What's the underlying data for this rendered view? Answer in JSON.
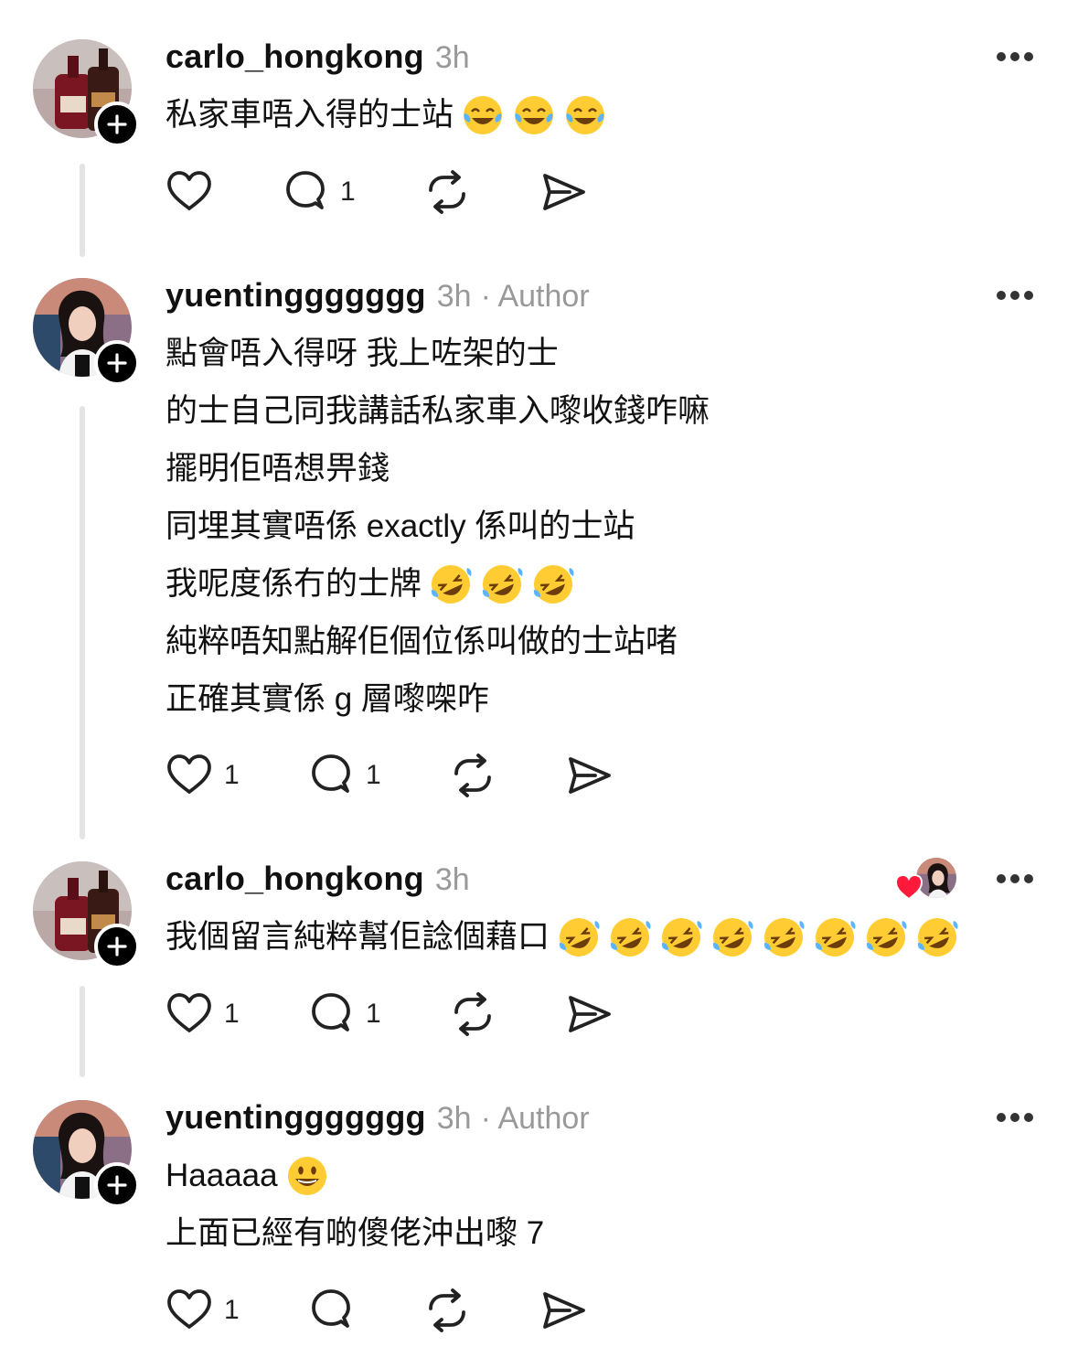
{
  "colors": {
    "text": "#111111",
    "meta": "#999999",
    "thread_line": "#e4e4e4",
    "heart": "#ff1a3c"
  },
  "icons": {
    "like": "heart-icon",
    "comment": "comment-bubble-icon",
    "repost": "repost-icon",
    "share": "send-icon",
    "more": "more-horizontal-icon",
    "follow": "plus-icon"
  },
  "comments": [
    {
      "username": "carlo_hongkong",
      "time": "3h",
      "author_tag": "",
      "avatar": "bottles-avatar",
      "lines": [
        "私家車唔入得的士站"
      ],
      "line_emojis": [
        [
          "tears-of-joy-emoji",
          "tears-of-joy-emoji",
          "tears-of-joy-emoji"
        ]
      ],
      "likes": "",
      "replies": "1"
    },
    {
      "username": "yuentinggggggg",
      "time": "3h",
      "author_tag": "· Author",
      "avatar": "woman-avatar",
      "lines": [
        "點會唔入得呀 我上咗架的士",
        "的士自己同我講話私家車入嚟收錢咋嘛",
        "擺明佢唔想畀錢",
        "同埋其實唔係 exactly 係叫的士站",
        "我呢度係冇的士牌",
        "純粹唔知點解佢個位係叫做的士站啫",
        "正確其實係 g 層嚟㗎咋"
      ],
      "line_emojis": [
        [],
        [],
        [],
        [],
        [
          "rolling-laughing-emoji",
          "rolling-laughing-emoji",
          "rolling-laughing-emoji"
        ],
        [],
        []
      ],
      "likes": "1",
      "replies": "1"
    },
    {
      "username": "carlo_hongkong",
      "time": "3h",
      "author_tag": "",
      "avatar": "bottles-avatar",
      "lines": [
        "我個留言純粹幫佢諗個藉口"
      ],
      "line_emojis": [
        [
          "rolling-laughing-emoji",
          "rolling-laughing-emoji",
          "rolling-laughing-emoji",
          "rolling-laughing-emoji",
          "rolling-laughing-emoji",
          "rolling-laughing-emoji",
          "rolling-laughing-emoji",
          "rolling-laughing-emoji"
        ]
      ],
      "likes": "1",
      "replies": "1",
      "liked_by_author": true
    },
    {
      "username": "yuentinggggggg",
      "time": "3h",
      "author_tag": "· Author",
      "avatar": "woman-avatar",
      "lines": [
        "Haaaaa",
        "上面已經有啲傻佬沖出嚟 7"
      ],
      "line_emojis": [
        [
          "grinning-face-emoji"
        ],
        []
      ],
      "likes": "1",
      "replies": ""
    }
  ]
}
